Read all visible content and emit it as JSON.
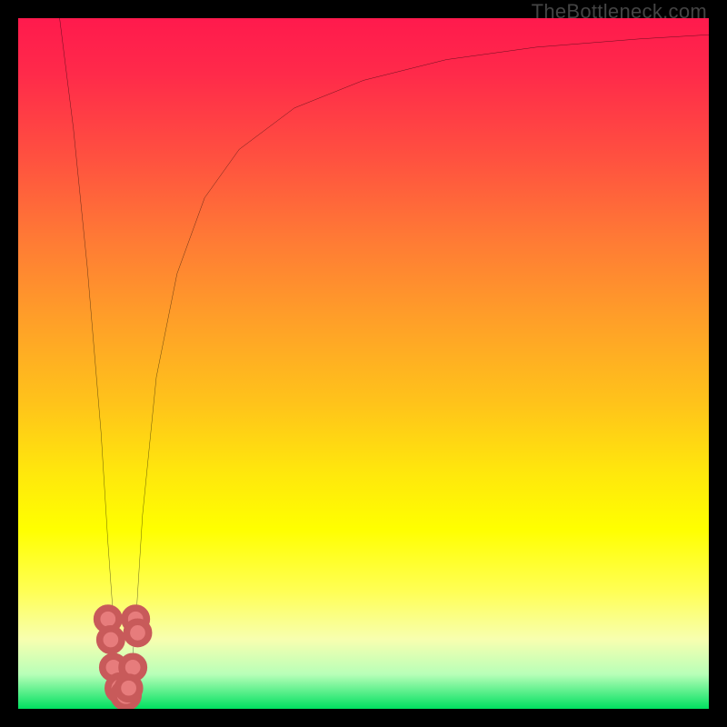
{
  "watermark": "TheBottleneck.com",
  "chart_data": {
    "type": "line",
    "title": "",
    "xlabel": "",
    "ylabel": "",
    "xlim": [
      0,
      100
    ],
    "ylim": [
      0,
      100
    ],
    "grid": false,
    "note": "Axes are unitless screen-normalized coordinates (0–100). Curve is a bottleneck-style chart: a steep descent to a minimum and an asymptotic rise. Values estimated from pixels.",
    "series": [
      {
        "name": "bottleneck-curve",
        "x": [
          6,
          8,
          10,
          12,
          13,
          14,
          15,
          15.5,
          16,
          17,
          18,
          20,
          23,
          27,
          32,
          40,
          50,
          62,
          75,
          90,
          100
        ],
        "y": [
          100,
          84,
          64,
          40,
          24,
          10,
          2,
          0,
          2,
          12,
          28,
          48,
          63,
          74,
          81,
          87,
          91,
          94,
          95.8,
          97,
          97.6
        ]
      }
    ],
    "scatter_points": {
      "name": "highlight-dots",
      "points": [
        {
          "x": 13.0,
          "y": 13.0,
          "r": 1.6
        },
        {
          "x": 13.4,
          "y": 10.0,
          "r": 1.6
        },
        {
          "x": 17.0,
          "y": 13.0,
          "r": 1.6
        },
        {
          "x": 17.3,
          "y": 11.0,
          "r": 1.6
        },
        {
          "x": 13.8,
          "y": 6.0,
          "r": 1.6
        },
        {
          "x": 16.6,
          "y": 6.0,
          "r": 1.6
        },
        {
          "x": 14.8,
          "y": 3.0,
          "r": 1.8
        },
        {
          "x": 15.6,
          "y": 2.0,
          "r": 1.8
        },
        {
          "x": 16.0,
          "y": 3.0,
          "r": 1.6
        }
      ]
    },
    "colors": {
      "curve": "#000000",
      "dots_fill": "#e77c7c",
      "dots_stroke": "#c85a5a",
      "gradient_top": "#ff1a4d",
      "gradient_mid": "#ffff00",
      "gradient_bottom": "#00e060",
      "frame": "#000000"
    }
  }
}
